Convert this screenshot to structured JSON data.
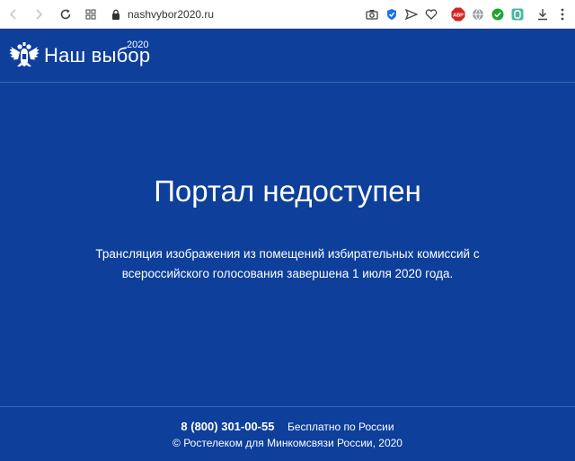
{
  "browser": {
    "url": "nashvybor2020.ru",
    "icons": [
      "back-arrow",
      "forward-arrow",
      "reload",
      "apps-grid",
      "lock",
      "camera",
      "shield",
      "send",
      "heart",
      "adblock-abp",
      "globe",
      "check",
      "vpn",
      "download",
      "menu"
    ],
    "abp_label": "ABP"
  },
  "header": {
    "logo_text": "Наш выбор",
    "logo_year": "2020"
  },
  "main": {
    "title": "Портал недоступен",
    "message_line1": "Трансляция изображения из помещений избирательных комиссий с",
    "message_line2": "всероссийского голосования завершена 1 июля 2020 года."
  },
  "footer": {
    "phone": "8 (800) 301-00-55",
    "phone_note": "Бесплатно по России",
    "copyright": "© Ростелеком для Минкомсвязи России, 2020"
  },
  "colors": {
    "background": "#0d3f9b",
    "divider": "#3d66b4",
    "text": "#ffffff"
  }
}
